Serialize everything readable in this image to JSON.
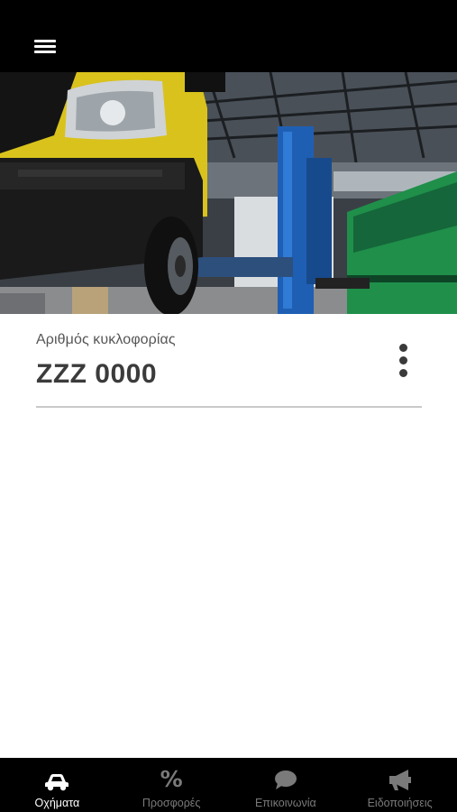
{
  "header": {
    "menu_icon": "hamburger-menu-icon"
  },
  "hero": {
    "image": "vehicle-on-service-lift-photo"
  },
  "vehicle": {
    "plate_label": "Αριθμός κυκλοφορίας",
    "plate_value": "ZZZ 0000",
    "more_icon": "more-vertical-icon"
  },
  "tabs": [
    {
      "label": "Οχήματα",
      "icon": "car-icon",
      "active": true
    },
    {
      "label": "Προσφορές",
      "icon": "percent-icon",
      "active": false
    },
    {
      "label": "Επικοινωνία",
      "icon": "chat-bubble-icon",
      "active": false
    },
    {
      "label": "Ειδοποιήσεις",
      "icon": "megaphone-icon",
      "active": false
    }
  ],
  "colors": {
    "bar_background": "#000000",
    "active_tab": "#ffffff",
    "inactive_tab": "#7a7a7a",
    "plate_text": "#3b3b3b"
  }
}
